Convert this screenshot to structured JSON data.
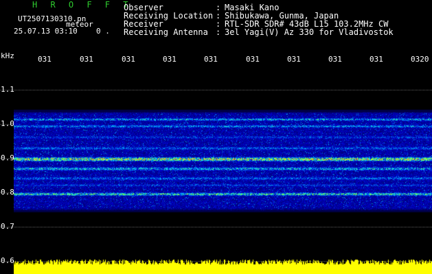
{
  "header": {
    "brand": "H R O F F T",
    "filename": "UT2507130310.pn",
    "meteor_label": "meteor",
    "datetime": "25.07.13 03:10",
    "count": "0 ."
  },
  "info": [
    {
      "label": "Observer",
      "value": "Masaki Kano"
    },
    {
      "label": "Receiving Location",
      "value": "Shibukawa, Gunma, Japan"
    },
    {
      "label": "Receiver",
      "value": "RTL-SDR SDR# 43dB L15 103.2MHz CW"
    },
    {
      "label": "Receiving Antenna",
      "value": "3el Yagi(V) Az 330 for Vladivostok"
    }
  ],
  "axis": {
    "unit": "kHz",
    "y_labels": [
      "1.1",
      "1.0",
      "0.9",
      "0.8",
      "0.7",
      "0.6"
    ],
    "time_labels": [
      "031",
      "031",
      "031",
      "031",
      "031",
      "031",
      "031",
      "031",
      "031",
      "0320"
    ]
  },
  "colors": {
    "brand": "#2ecc2e",
    "background": "#000000",
    "baseline_fill": "#ffff00",
    "strong_echo": "#ff3030"
  }
}
